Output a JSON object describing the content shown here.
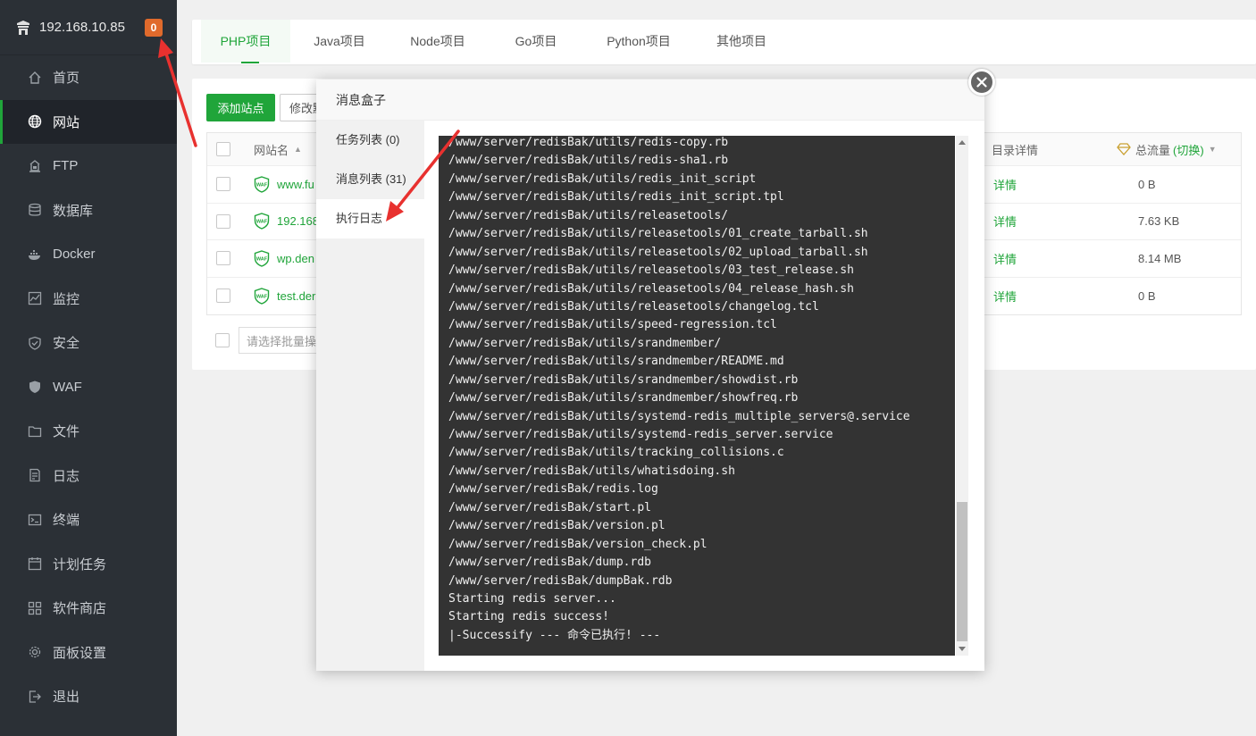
{
  "sidebar": {
    "server_ip": "192.168.10.85",
    "badge_count": "0",
    "items": [
      {
        "label": "首页",
        "icon": "home-icon"
      },
      {
        "label": "网站",
        "icon": "globe-icon",
        "active": true
      },
      {
        "label": "FTP",
        "icon": "ftp-icon"
      },
      {
        "label": "数据库",
        "icon": "database-icon"
      },
      {
        "label": "Docker",
        "icon": "docker-icon"
      },
      {
        "label": "监控",
        "icon": "monitor-icon"
      },
      {
        "label": "安全",
        "icon": "shield-icon"
      },
      {
        "label": "WAF",
        "icon": "waf-icon"
      },
      {
        "label": "文件",
        "icon": "folder-icon"
      },
      {
        "label": "日志",
        "icon": "log-icon"
      },
      {
        "label": "终端",
        "icon": "terminal-icon"
      },
      {
        "label": "计划任务",
        "icon": "calendar-icon"
      },
      {
        "label": "软件商店",
        "icon": "apps-icon"
      },
      {
        "label": "面板设置",
        "icon": "gear-icon"
      },
      {
        "label": "退出",
        "icon": "logout-icon"
      }
    ]
  },
  "tabs": [
    "PHP项目",
    "Java项目",
    "Node项目",
    "Go项目",
    "Python项目",
    "其他项目"
  ],
  "toolbar": {
    "add_site": "添加站点",
    "modify": "修改默"
  },
  "table": {
    "headers": {
      "name": "网站名",
      "detail": "目录详情",
      "traffic": "总流量",
      "switch": "(切换)"
    },
    "rows": [
      {
        "name": "www.fu",
        "detail": "详情",
        "traffic": "0 B"
      },
      {
        "name": "192.168",
        "detail": "详情",
        "traffic": "7.63 KB"
      },
      {
        "name": "wp.den",
        "detail": "详情",
        "traffic": "8.14 MB"
      },
      {
        "name": "test.der",
        "detail": "详情",
        "traffic": "0 B"
      }
    ],
    "batch_placeholder": "请选择批量操作"
  },
  "modal": {
    "title": "消息盒子",
    "tabs": [
      "任务列表 (0)",
      "消息列表 (31)",
      "执行日志"
    ],
    "log_lines": [
      "/www/server/redisBak/utils/redis-copy.rb",
      "/www/server/redisBak/utils/redis-sha1.rb",
      "/www/server/redisBak/utils/redis_init_script",
      "/www/server/redisBak/utils/redis_init_script.tpl",
      "/www/server/redisBak/utils/releasetools/",
      "/www/server/redisBak/utils/releasetools/01_create_tarball.sh",
      "/www/server/redisBak/utils/releasetools/02_upload_tarball.sh",
      "/www/server/redisBak/utils/releasetools/03_test_release.sh",
      "/www/server/redisBak/utils/releasetools/04_release_hash.sh",
      "/www/server/redisBak/utils/releasetools/changelog.tcl",
      "/www/server/redisBak/utils/speed-regression.tcl",
      "/www/server/redisBak/utils/srandmember/",
      "/www/server/redisBak/utils/srandmember/README.md",
      "/www/server/redisBak/utils/srandmember/showdist.rb",
      "/www/server/redisBak/utils/srandmember/showfreq.rb",
      "/www/server/redisBak/utils/systemd-redis_multiple_servers@.service",
      "/www/server/redisBak/utils/systemd-redis_server.service",
      "/www/server/redisBak/utils/tracking_collisions.c",
      "/www/server/redisBak/utils/whatisdoing.sh",
      "/www/server/redisBak/redis.log",
      "/www/server/redisBak/start.pl",
      "/www/server/redisBak/version.pl",
      "/www/server/redisBak/version_check.pl",
      "/www/server/redisBak/dump.rdb",
      "/www/server/redisBak/dumpBak.rdb",
      "Starting redis server...",
      "Starting redis success!",
      "|-Successify --- 命令已执行! ---"
    ]
  },
  "colors": {
    "accent": "#20a53a",
    "sidebar_bg": "#2b3036",
    "badge": "#e06a2c",
    "annotation_arrow": "#e8312f"
  }
}
